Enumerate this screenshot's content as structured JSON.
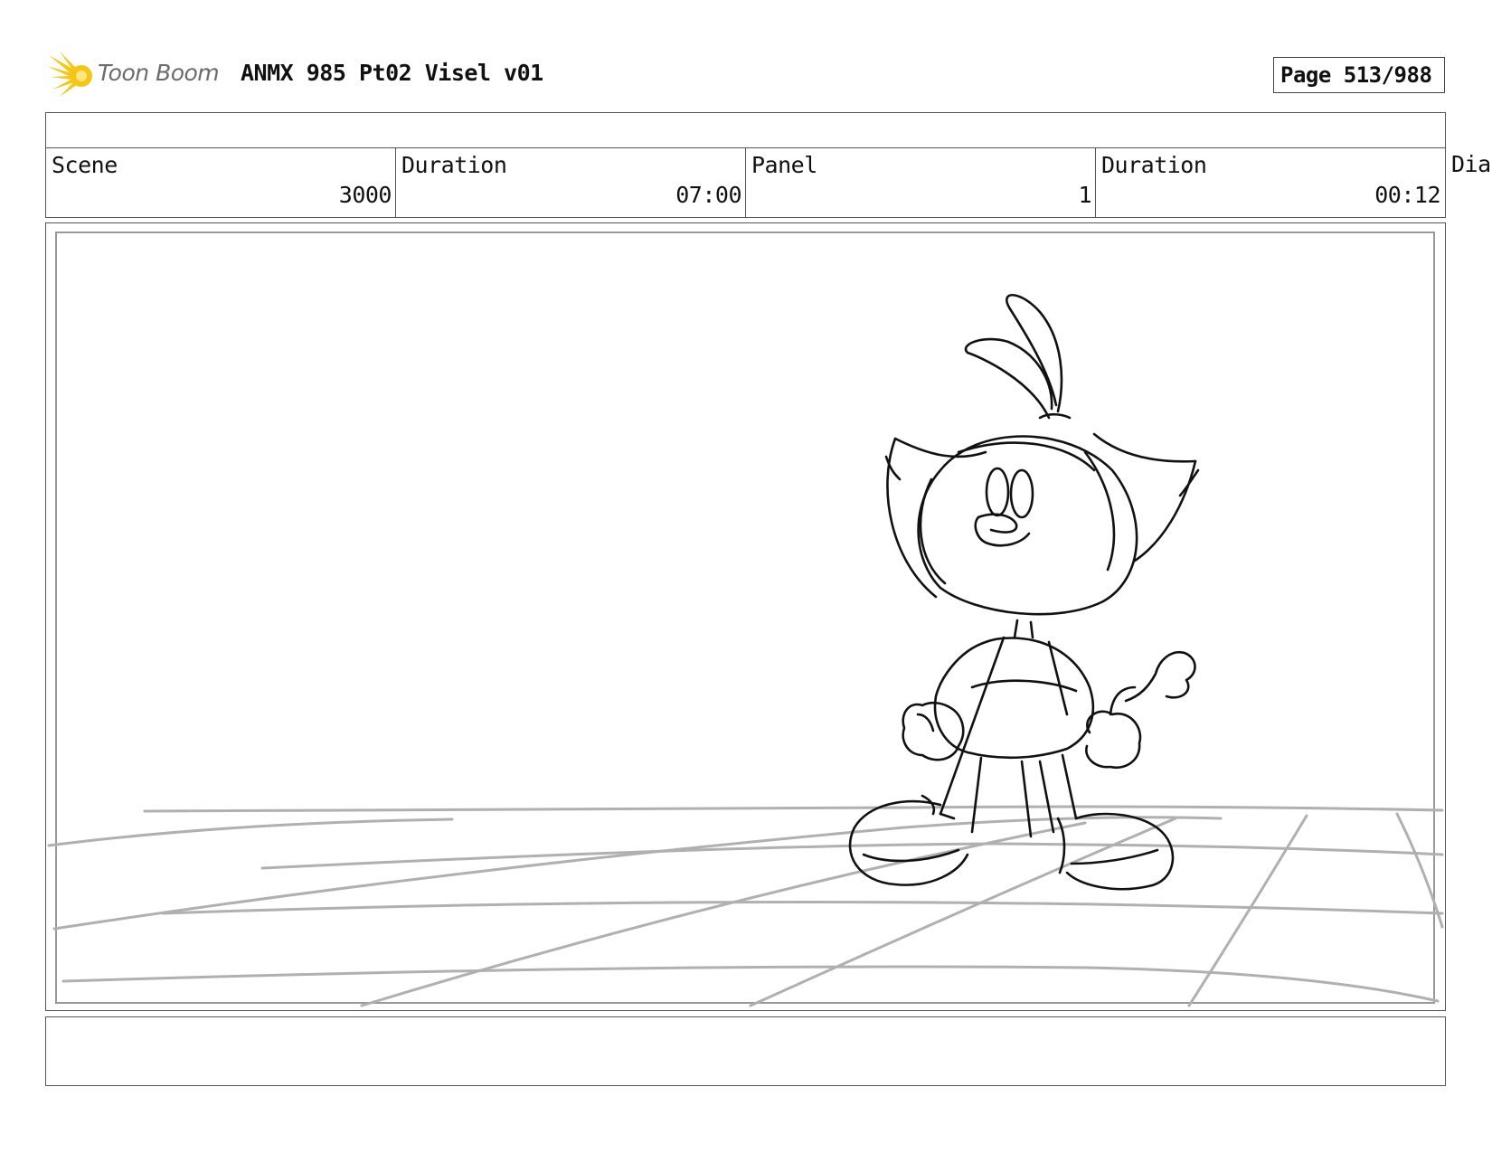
{
  "header": {
    "logo_text": "Toon Boom",
    "document_title": "ANMX 985 Pt02 Visel v01",
    "page_label": "Page 513/988"
  },
  "info": {
    "scene_label": "Scene",
    "scene_value": "3000",
    "scene_duration_label": "Duration",
    "scene_duration_value": "07:00",
    "panel_label": "Panel",
    "panel_value": "1",
    "panel_duration_label": "Duration",
    "panel_duration_value": "00:12",
    "dialogue_label": "Dia"
  },
  "colors": {
    "logo_star": "#f5c518",
    "sketch_line": "#111111",
    "floor_line": "#b0b0b0"
  },
  "icons": {
    "logo": "toon-boom-star-icon"
  }
}
